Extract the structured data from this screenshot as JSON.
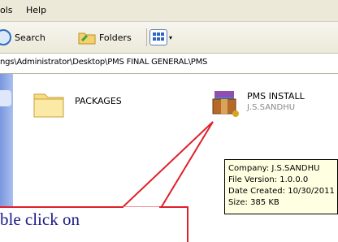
{
  "menu": {
    "items": [
      "ols",
      "Help"
    ]
  },
  "toolbar": {
    "search_label": "Search",
    "folders_label": "Folders"
  },
  "address": {
    "path": "ngs\\Administrator\\Desktop\\PMS FINAL GENERAL\\PMS"
  },
  "files": [
    {
      "name": "PACKAGES",
      "icon": "folder-icon"
    },
    {
      "name": "PMS INSTALL",
      "subtitle": "J.S.SANDHU",
      "icon": "archive-icon"
    }
  ],
  "tooltip": {
    "company": "Company: J.S.SANDHU",
    "version": "File Version: 1.0.0.0",
    "created": "Date Created: 10/30/2011",
    "size": "Size: 385 KB"
  },
  "callout": {
    "text": "ble click on",
    "accent": "#e0202a"
  }
}
